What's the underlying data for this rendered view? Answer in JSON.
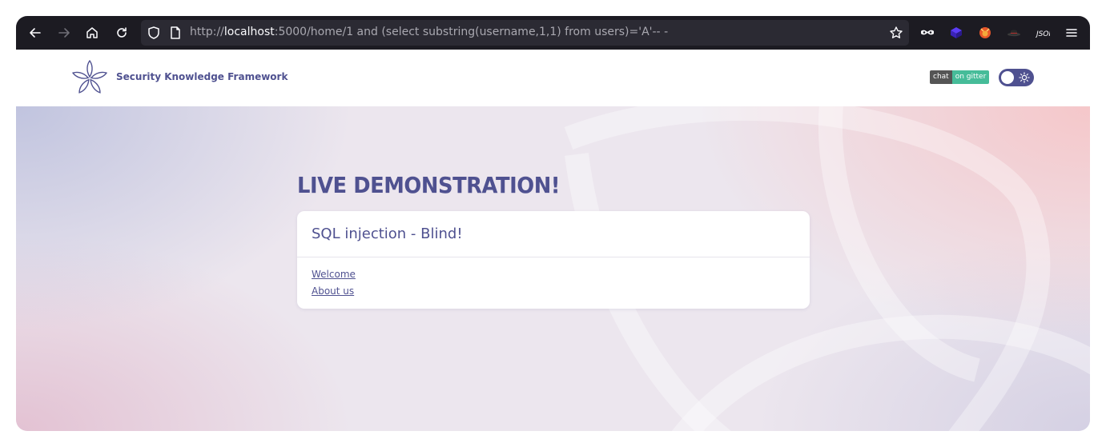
{
  "browser": {
    "url_scheme": "http://",
    "url_host": "localhost",
    "url_rest": ":5000/home/1 and (select substring(username,1,1) from users)='A'-- -",
    "toolbar_bg": "#1c1b22",
    "urlbar_bg": "#2b2a33"
  },
  "header": {
    "brand": "Security Knowledge Framework",
    "badge_left": "chat",
    "badge_right": "on gitter",
    "accent": "#4f5190"
  },
  "main": {
    "heading": "LIVE DEMONSTRATION!",
    "card_title": "SQL injection - Blind!",
    "links": [
      "Welcome",
      "About us"
    ]
  },
  "icons": [
    "back-icon",
    "forward-icon",
    "home-icon",
    "reload-icon",
    "shield-icon",
    "page-icon",
    "star-icon",
    "extension-mask-icon",
    "extension-cube-icon",
    "extension-fox-icon",
    "extension-hat-icon",
    "extension-json-icon",
    "menu-icon",
    "logo-icon",
    "sun-icon"
  ]
}
